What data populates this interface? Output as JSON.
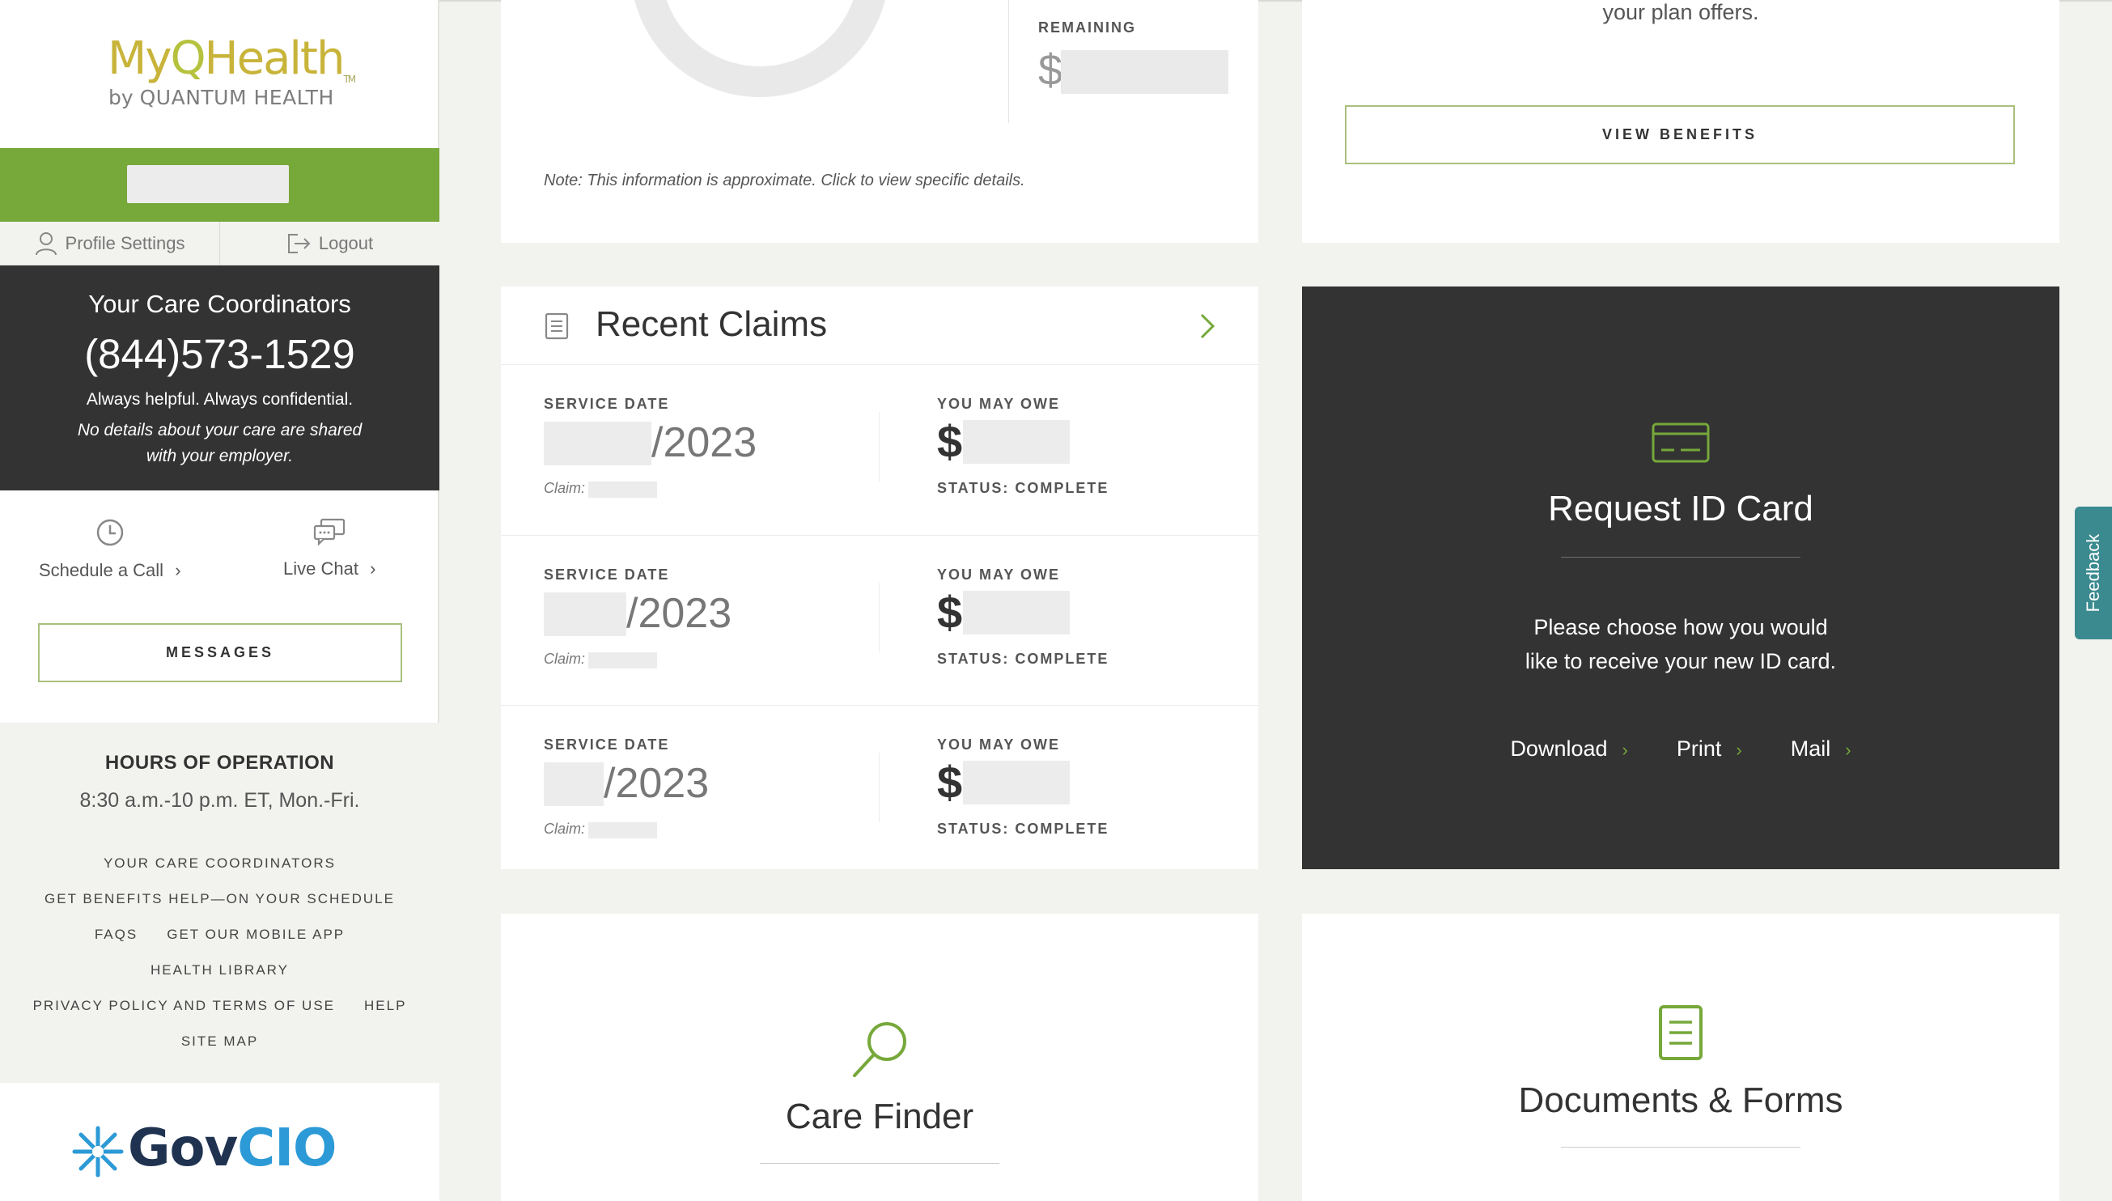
{
  "brand": {
    "logo_my": "My",
    "logo_q": "Q",
    "logo_health": "Health",
    "logo_tm": "TM",
    "logo_by": "by",
    "logo_company": "QUANTUM HEALTH"
  },
  "account": {
    "profile_settings": "Profile Settings",
    "logout": "Logout"
  },
  "care_coordinators": {
    "title": "Your Care Coordinators",
    "phone": "(844)573-1529",
    "tagline": "Always helpful. Always confidential.",
    "privacy_note": "No details about your care are shared with your employer."
  },
  "contact_actions": {
    "schedule_call": "Schedule a Call",
    "live_chat": "Live Chat",
    "chevron": "›"
  },
  "messages_button": "MESSAGES",
  "hours": {
    "title": "HOURS OF OPERATION",
    "time": "8:30 a.m.-10 p.m. ET, Mon.-Fri."
  },
  "footer_links": {
    "care_coordinators": "YOUR CARE COORDINATORS",
    "benefits_help": "GET BENEFITS HELP—ON YOUR SCHEDULE",
    "faqs": "FAQS",
    "mobile_app": "GET OUR MOBILE APP",
    "health_library": "HEALTH LIBRARY",
    "privacy_terms": "PRIVACY POLICY AND TERMS OF USE",
    "help": "HELP",
    "site_map": "SITE MAP"
  },
  "govcio": {
    "gov": "Gov",
    "cio": "CIO"
  },
  "deductible_card": {
    "remaining_label": "REMAINING",
    "dollar": "$",
    "note": "Note: This information is approximate. Click to view specific details."
  },
  "benefits_card": {
    "plan_offers": "your plan offers.",
    "view_benefits": "VIEW BENEFITS"
  },
  "recent_claims": {
    "title": "Recent Claims",
    "service_date_label": "SERVICE DATE",
    "you_may_owe_label": "YOU MAY OWE",
    "claim_label": "Claim:",
    "dollar": "$",
    "rows": [
      {
        "year": "/2023",
        "status": "STATUS: COMPLETE"
      },
      {
        "year": "/2023",
        "status": "STATUS: COMPLETE"
      },
      {
        "year": "/2023",
        "status": "STATUS: COMPLETE"
      }
    ]
  },
  "id_card": {
    "title": "Request ID Card",
    "desc_line1": "Please choose how you would",
    "desc_line2": "like to receive your new ID card.",
    "options": [
      "Download",
      "Print",
      "Mail"
    ],
    "chevron": "›"
  },
  "care_finder": {
    "title": "Care Finder"
  },
  "documents": {
    "title": "Documents & Forms"
  },
  "feedback": "Feedback",
  "colors": {
    "accent_green": "#76a83a",
    "dark_panel": "#333333",
    "feedback_teal": "#3a8a8f",
    "govcio_navy": "#1f3350",
    "govcio_blue": "#2c9ad6"
  }
}
